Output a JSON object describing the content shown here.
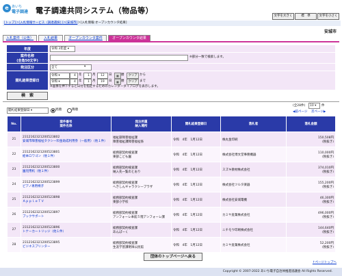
{
  "header": {
    "logo_mark": "e",
    "logo_line1": "あいち",
    "logo_line2": "電子調達",
    "title": "電子調達共同システム（物品等）",
    "font_buttons": [
      "文字を大きく",
      "標　準",
      "文字を小さく"
    ]
  },
  "breadcrumb": {
    "items": [
      "[トップ]",
      "＞[入札情報サービス（調達選択）]",
      "＞[安城市]",
      "＞[入札情報:オープンカウンタ結果]"
    ]
  },
  "organization": "安城市",
  "tabs": [
    "入札案件（公告）",
    "入札結果",
    "オープンカウンタ案件",
    "オープンカウンタ結果"
  ],
  "search": {
    "year_label": "年度",
    "year_value": "令和 3年度",
    "case_name_label": "案件名称",
    "case_name_sub": "(全角50文字)",
    "case_name_value": "",
    "case_name_note": "※部分一致で検索します。",
    "order_type_label": "発注区分",
    "order_type_value": "全て",
    "date_label": "開札結果登録日",
    "date_from": {
      "era": "令和",
      "year": "4",
      "month": "1",
      "day": "12"
    },
    "date_to": {
      "era": "令和",
      "year": "4",
      "month": "1",
      "day": "19"
    },
    "unit_year": "年",
    "unit_month": "月",
    "unit_day": "日",
    "cal_icon": "▦",
    "cal_label": "暦",
    "clear_label": "クリア",
    "from_label": "から",
    "to_label": "まで",
    "date_note": "※画像を押下すると日付を指定するためのカレンダーダイアログを表示します。",
    "search_button": "検　索"
  },
  "list_controls": {
    "sort_value": "開札結果登録日",
    "asc_label": "昇順",
    "desc_label": "降順",
    "page_status": "(全28件)",
    "per_page": "10",
    "per_page_suffix": "件",
    "prev_label": "前ページ",
    "next_label": "次ページ"
  },
  "table": {
    "headers": {
      "no": "No.",
      "case": [
        "案件番号",
        "案件名称"
      ],
      "dept": [
        "発注所属",
        "納入場所"
      ],
      "date": "開札結果登録日",
      "winner": "落札者",
      "amount": "落札金額"
    },
    "rows": [
      {
        "no": "21",
        "case_no": "2312162321200523802",
        "case_name": "安城市障害福祉タクシー料金助成利用券（一般用）（他１件）",
        "dept": "福祉部障害福祉課",
        "place": "障害福祉課障害福祉係",
        "date": "令和　4年　1月12日",
        "winner": "株丸金印刷",
        "amount": "150,508円",
        "tax": "(税抜き)"
      },
      {
        "no": "22",
        "case_no": "2312162321200523801",
        "case_name": "絵本ロワゴン（他１件）",
        "dept": "総務部契約検査課",
        "place": "東部こども園",
        "date": "令和　4年　1月12日",
        "winner": "株式会社博文堂事務機器",
        "amount": "110,000円",
        "tax": "(税抜き)"
      },
      {
        "no": "23",
        "case_no": "2312162321200523800",
        "case_name": "園児用机（他１件）",
        "dept": "総務部契約検査課",
        "place": "納入先一覧のとおり",
        "date": "令和　4年　1月12日",
        "winner": "スズキ教材株式会社",
        "amount": "374,010円",
        "tax": "(税抜き)"
      },
      {
        "no": "24",
        "case_no": "2312162321200523899",
        "case_name": "ピアノ専用椅子",
        "dept": "総務部契約検査課",
        "place": "へきしんギャラクシープラザ",
        "date": "令和　4年　1月12日",
        "winner": "株式会社ツルタ楽器",
        "amount": "155,200円",
        "tax": "(税抜き)"
      },
      {
        "no": "25",
        "case_no": "2312162321200523898",
        "case_name": "ＡｐｐｌｅＴＶ",
        "dept": "総務部契約検査課",
        "place": "東部小学校",
        "date": "令和　4年　1月12日",
        "winner": "株式会社安城電機",
        "amount": "46,300円",
        "tax": "(税抜き)"
      },
      {
        "no": "26",
        "case_no": "2312162321200523897",
        "case_name": "ブックサポート",
        "dept": "総務部契約検査課",
        "place": "アンフォーレ本館５階アンフォーレ課",
        "date": "令和　4年　1月12日",
        "winner": "カミヤ産業株式会社",
        "amount": "496,000円",
        "tax": "(税抜き)"
      },
      {
        "no": "27",
        "case_no": "2312162321200523896",
        "case_name": "トナーカートリッジ（他１件）",
        "dept": "総務部契約検査課",
        "place": "あんぱーく",
        "date": "令和　4年　1月12日",
        "winner": "ニチモウ印刷株式会社",
        "amount": "144,640円",
        "tax": "(税抜き)"
      },
      {
        "no": "28",
        "case_no": "2312162321200523895",
        "case_name": "ビジネスプリンター",
        "dept": "総務部契約検査課",
        "place": "生涯学習課明祥公民館",
        "date": "令和　4年　1月12日",
        "winner": "カミヤ産業株式会社",
        "amount": "52,200円",
        "tax": "(税抜き)"
      }
    ]
  },
  "back_button": "団体のトップページへ戻る",
  "page_top": "↑ページトップへ",
  "footer": "Copyright © 2007-2022 あいち電子自治体推進協議会 All Rights Reserved."
}
